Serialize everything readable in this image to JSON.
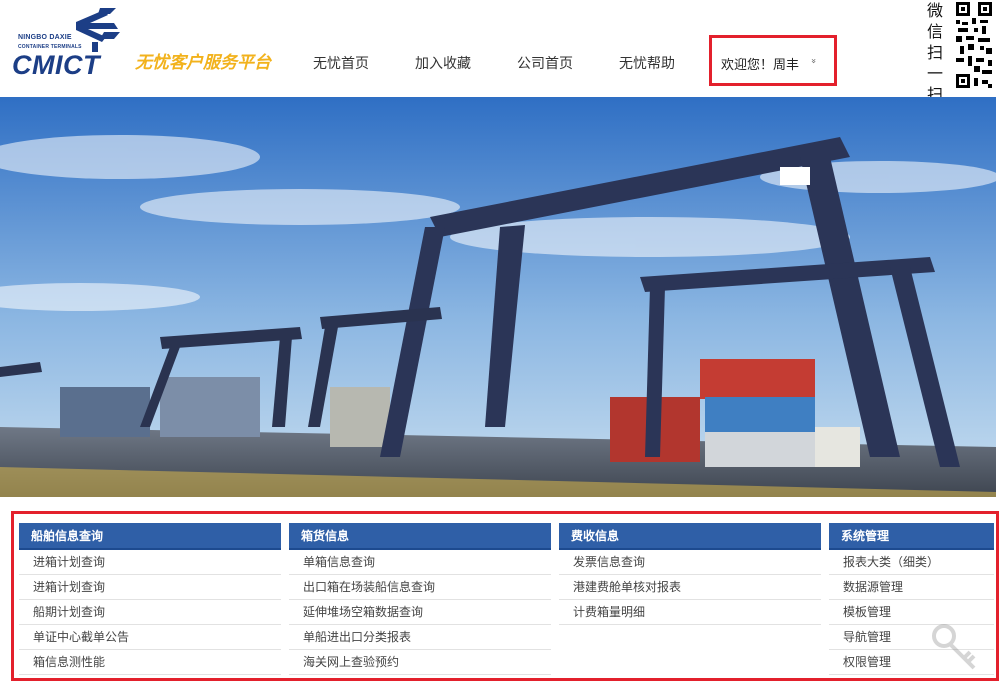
{
  "header": {
    "logo": {
      "line1": "NINGBO DAXIE",
      "line2": "CONTAINER TERMINALS",
      "word": "CMICT"
    },
    "slogan": "无忧客户服务平台",
    "nav": [
      {
        "label": "无忧首页"
      },
      {
        "label": "加入收藏"
      },
      {
        "label": "公司首页"
      },
      {
        "label": "无忧帮助"
      }
    ],
    "user": {
      "greeting": "欢迎您！周丰",
      "chevron": "»"
    },
    "wechat_label": [
      "微",
      "信",
      "扫",
      "一",
      "扫"
    ]
  },
  "menu": {
    "columns": [
      {
        "title": "船舶信息查询",
        "items": [
          "进箱计划查询",
          "进箱计划查询",
          "船期计划查询",
          "单证中心截单公告",
          "箱信息测性能"
        ]
      },
      {
        "title": "箱货信息",
        "items": [
          "单箱信息查询",
          "出口箱在场装船信息查询",
          "延伸堆场空箱数据查询",
          "单船进出口分类报表",
          "海关网上查验预约"
        ]
      },
      {
        "title": "费收信息",
        "items": [
          "发票信息查询",
          "港建费舱单核对报表",
          "计费箱量明细"
        ]
      },
      {
        "title": "系统管理",
        "items": [
          "报表大类（细类）",
          "数据源管理",
          "模板管理",
          "导航管理",
          "权限管理"
        ]
      }
    ]
  },
  "colors": {
    "brand_blue": "#1c3e86",
    "slogan_yellow": "#f2b21c",
    "menu_header": "#2f5fa7",
    "highlight_red": "#e3202c"
  }
}
